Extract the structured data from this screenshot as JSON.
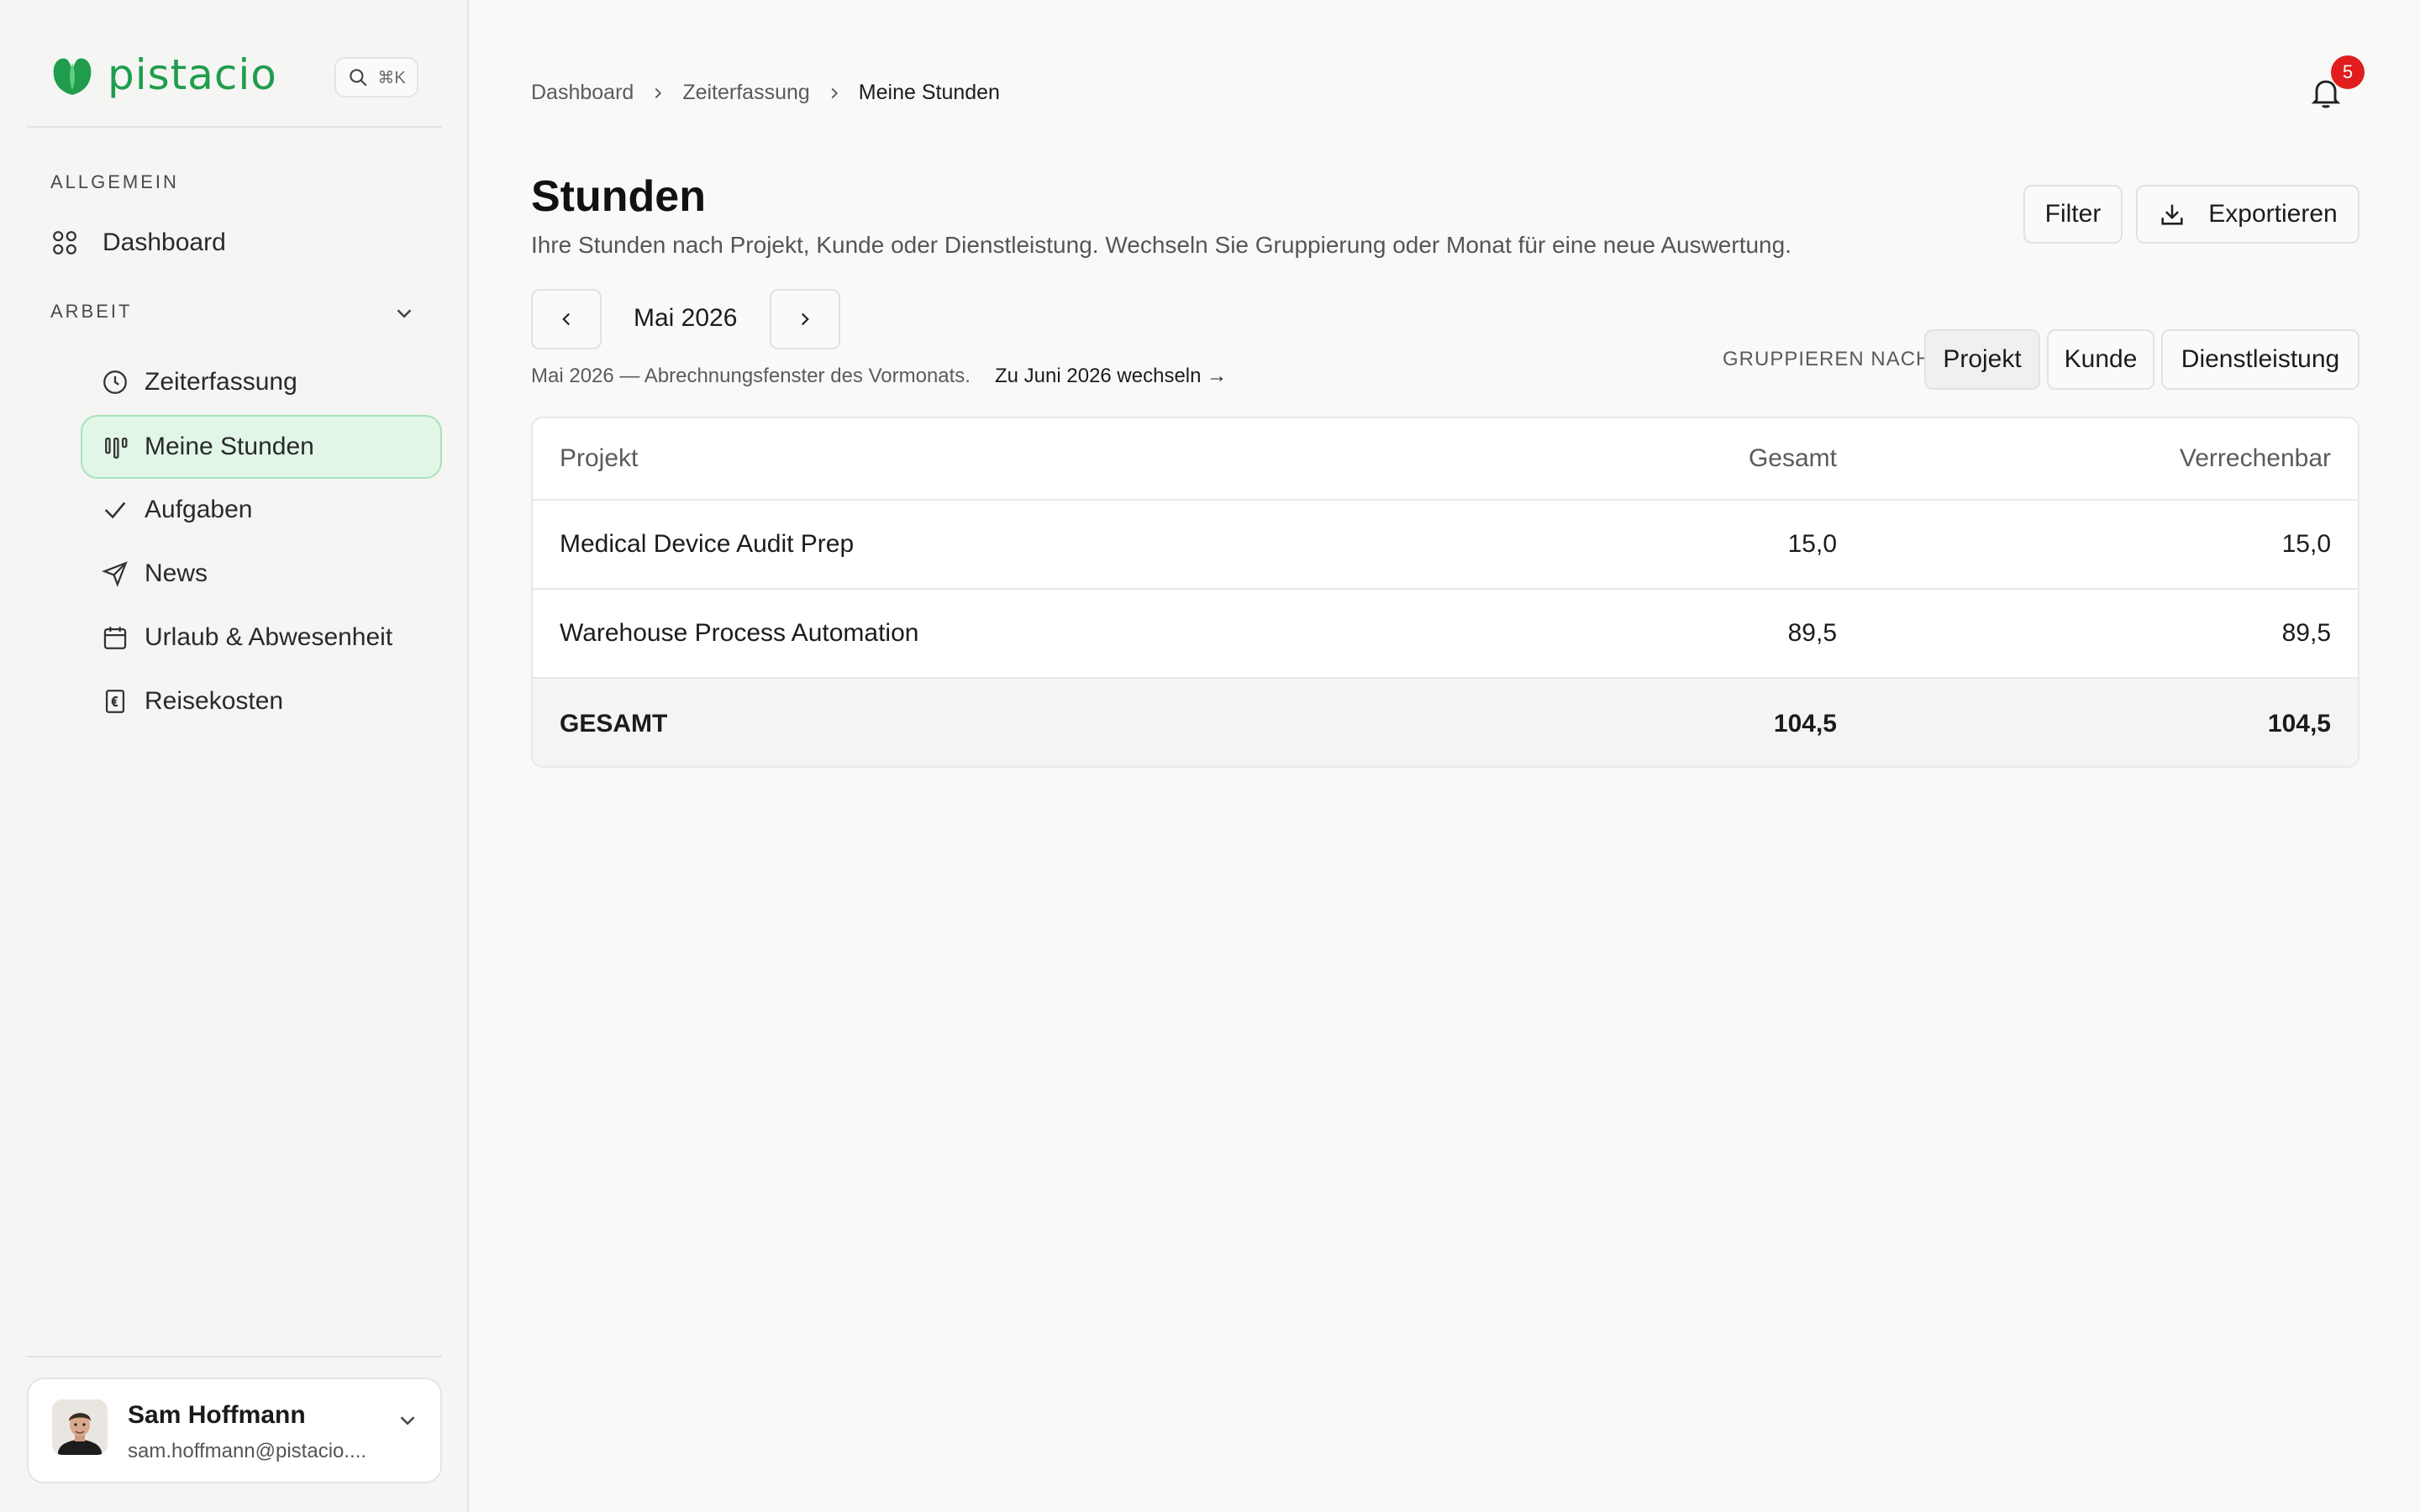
{
  "brand": {
    "name": "pistacio",
    "logo_color": "#1f9d4c"
  },
  "search": {
    "shortcut": "⌘K"
  },
  "sidebar": {
    "section_general": "ALLGEMEIN",
    "dashboard": "Dashboard",
    "section_work": "ARBEIT",
    "items": [
      {
        "label": "Zeiterfassung",
        "icon": "clock-icon"
      },
      {
        "label": "Meine Stunden",
        "icon": "bars-icon",
        "active": true
      },
      {
        "label": "Aufgaben",
        "icon": "check-icon"
      },
      {
        "label": "News",
        "icon": "send-icon"
      },
      {
        "label": "Urlaub & Abwesenheit",
        "icon": "calendar-icon"
      },
      {
        "label": "Reisekosten",
        "icon": "receipt-icon"
      }
    ]
  },
  "user": {
    "name": "Sam Hoffmann",
    "email": "sam.hoffmann@pistacio...."
  },
  "breadcrumb": [
    "Dashboard",
    "Zeiterfassung",
    "Meine Stunden"
  ],
  "notifications": {
    "count": "5"
  },
  "page": {
    "title": "Stunden",
    "subtitle": "Ihre Stunden nach Projekt, Kunde oder Dienstleistung. Wechseln Sie Gruppierung oder Monat für eine neue Auswertung.",
    "filter_label": "Filter",
    "export_label": "Exportieren"
  },
  "month": {
    "label": "Mai 2026",
    "hint": "Mai 2026 — Abrechnungsfenster des Vormonats.",
    "switch_link": "Zu Juni 2026 wechseln →"
  },
  "grouping": {
    "label": "GRUPPIEREN NACH",
    "options": [
      "Projekt",
      "Kunde",
      "Dienstleistung"
    ],
    "selected": "Projekt"
  },
  "table": {
    "headers": [
      "Projekt",
      "Gesamt",
      "Verrechenbar"
    ],
    "rows": [
      {
        "name": "Medical Device Audit Prep",
        "gesamt": "15,0",
        "verrechenbar": "15,0"
      },
      {
        "name": "Warehouse Process Automation",
        "gesamt": "89,5",
        "verrechenbar": "89,5"
      }
    ],
    "total": {
      "name": "GESAMT",
      "gesamt": "104,5",
      "verrechenbar": "104,5"
    }
  }
}
